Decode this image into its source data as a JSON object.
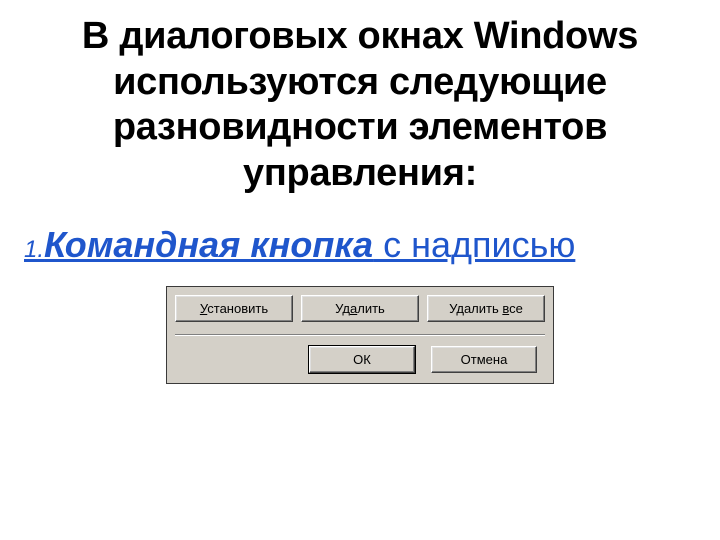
{
  "slide": {
    "title": "В диалоговых окнах Windows используются следующие разновидности элементов управления:",
    "subheading_num": "1.",
    "subheading_bold": "Командная кнопка",
    "subheading_rest": " с надписью"
  },
  "panel": {
    "buttons_row1": [
      {
        "pre": "",
        "u": "У",
        "post": "становить",
        "name": "install-button"
      },
      {
        "pre": "Уд",
        "u": "а",
        "post": "лить",
        "name": "delete-button"
      },
      {
        "pre": "Удалить ",
        "u": "в",
        "post": "се",
        "name": "delete-all-button"
      }
    ],
    "buttons_row2": [
      {
        "label": "ОК",
        "name": "ok-button",
        "default": true
      },
      {
        "label": "Отмена",
        "name": "cancel-button",
        "default": false
      }
    ]
  }
}
